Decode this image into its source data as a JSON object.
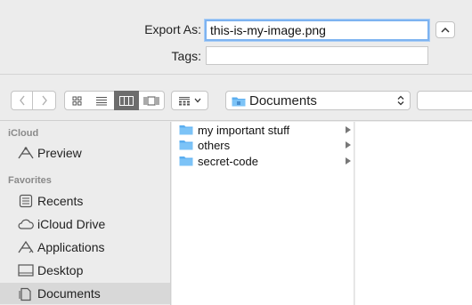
{
  "export": {
    "export_as_label": "Export As:",
    "filename": "this-is-my-image.png",
    "tags_label": "Tags:",
    "tags_value": ""
  },
  "toolbar": {
    "location": "Documents"
  },
  "sidebar": {
    "sections": [
      {
        "title": "iCloud",
        "items": [
          {
            "label": "Preview",
            "icon": "preview-icon"
          }
        ]
      },
      {
        "title": "Favorites",
        "items": [
          {
            "label": "Recents",
            "icon": "recents-icon"
          },
          {
            "label": "iCloud Drive",
            "icon": "cloud-icon"
          },
          {
            "label": "Applications",
            "icon": "applications-icon"
          },
          {
            "label": "Desktop",
            "icon": "desktop-icon"
          },
          {
            "label": "Documents",
            "icon": "documents-icon",
            "selected": true
          }
        ]
      }
    ]
  },
  "browser": {
    "items": [
      {
        "name": "my important stuff",
        "icon": "folder-icon"
      },
      {
        "name": "others",
        "icon": "folder-icon"
      },
      {
        "name": "secret-code",
        "icon": "folder-icon"
      }
    ]
  },
  "colors": {
    "folder": "#5aaef0",
    "focus_ring": "#7db3f0",
    "selected_view": "#6d6d6d"
  }
}
